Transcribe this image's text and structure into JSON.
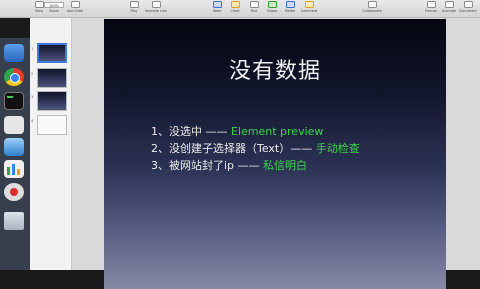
{
  "toolbar": {
    "view_label": "View",
    "zoom_value": "100%",
    "zoom_label": "Zoom",
    "add_slide_label": "Add Slide",
    "play_label": "Play",
    "keynote_live_label": "Keynote Live",
    "table_label": "Table",
    "chart_label": "Chart",
    "text_label": "Text",
    "shape_label": "Shape",
    "media_label": "Media",
    "comment_label": "Comment",
    "collaborate_label": "Collaborate",
    "format_label": "Format",
    "animate_label": "Animate",
    "document_label": "Document"
  },
  "navigator": {
    "slides": [
      {
        "number": "1",
        "style": "dark"
      },
      {
        "number": "2",
        "style": "dark"
      },
      {
        "number": "3",
        "style": "dark"
      },
      {
        "number": "4",
        "style": "light"
      }
    ]
  },
  "slide": {
    "title": "没有数据",
    "bullets": [
      {
        "text": "1、没选中 —— ",
        "highlight": "Element preview"
      },
      {
        "text": "2、没创建子选择器（Text）—— ",
        "highlight": "手动检查"
      },
      {
        "text": "3、被网站封了ip —— ",
        "highlight": "私信明白"
      }
    ],
    "highlight_color": "#3fd14f",
    "text_color": "#eeeeee"
  }
}
